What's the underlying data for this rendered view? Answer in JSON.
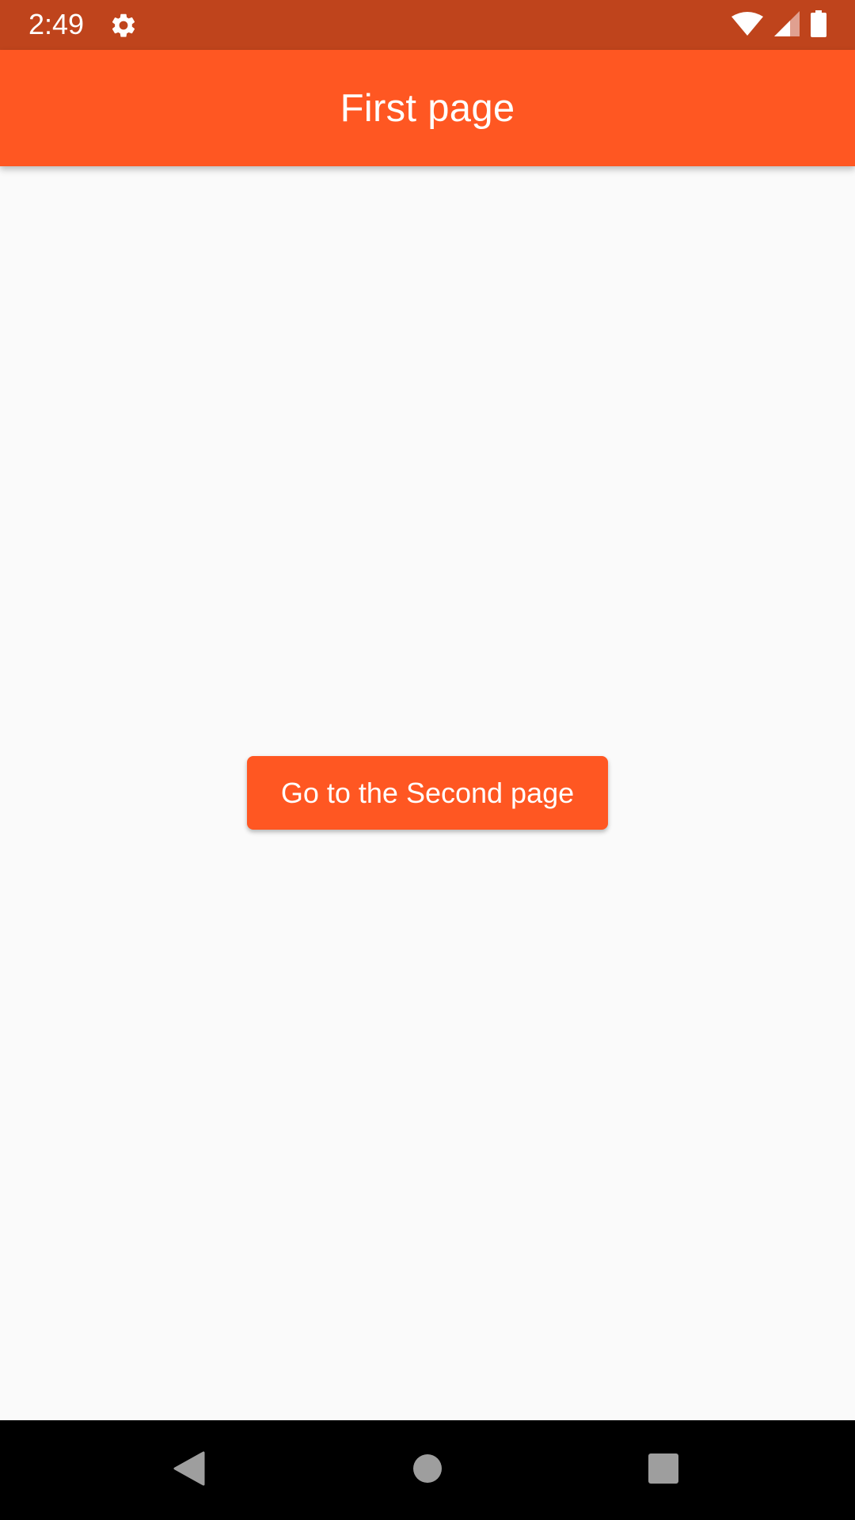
{
  "status_bar": {
    "time": "2:49",
    "icons": [
      "gear-icon",
      "wifi-icon",
      "cellular-signal-icon",
      "battery-icon"
    ]
  },
  "app_bar": {
    "title": "First page",
    "color": "#ff5722"
  },
  "main": {
    "button_label": "Go to the Second page"
  },
  "nav_bar": {
    "icons": [
      "back-icon",
      "home-icon",
      "recents-icon"
    ]
  },
  "colors": {
    "primary": "#ff5722",
    "primary_dark": "#bf441c",
    "background": "#fafafa",
    "nav_icon": "#9e9e9e"
  }
}
